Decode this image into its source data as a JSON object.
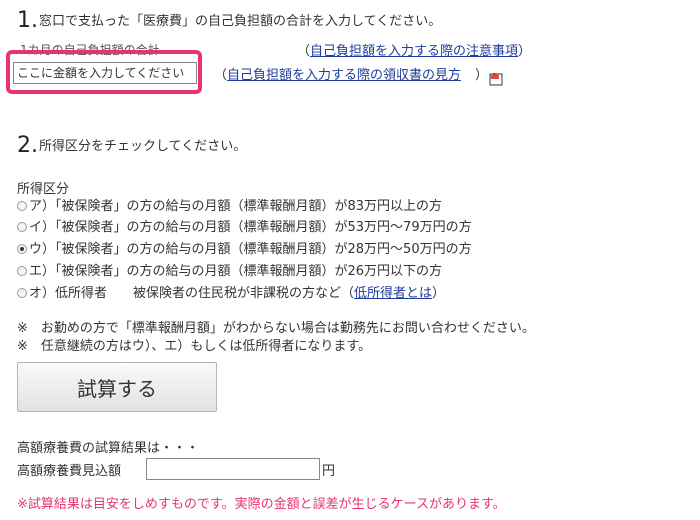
{
  "section1": {
    "number": "1.",
    "heading": "窓口で支払った「医療費」の自己負担額の合計を入力してください。",
    "field_label": "1カ月の自己負担額の合計",
    "input_placeholder": "ここに金額を入力してください",
    "link_notes_open": "（",
    "link_notes": "自己負担額を入力する際の注意事項",
    "link_notes_close": "）",
    "link_receipt_open": "（",
    "link_receipt": "自己負担額を入力する際の領収書の見方",
    "link_receipt_close": "）"
  },
  "section2": {
    "number": "2.",
    "heading": "所得区分をチェックしてください。",
    "group_label": "所得区分",
    "options": [
      {
        "label": "ア）「被保険者」の方の給与の月額（標準報酬月額）が83万円以上の方",
        "checked": false
      },
      {
        "label": "イ）「被保険者」の方の給与の月額（標準報酬月額）が53万円～79万円の方",
        "checked": false
      },
      {
        "label": "ウ）「被保険者」の方の給与の月額（標準報酬月額）が28万円～50万円の方",
        "checked": true
      },
      {
        "label": "エ）「被保険者」の方の給与の月額（標準報酬月額）が26万円以下の方",
        "checked": false
      }
    ],
    "option_o_label": "オ）低所得者　　被保険者の住民税が非課税の方など（",
    "option_o_link": "低所得者とは",
    "option_o_close": "）",
    "note1": "※　お勤めの方で「標準報酬月額」がわからない場合は勤務先にお問い合わせください。",
    "note2": "※　任意継続の方はウ）、エ）もしくは低所得者になります。"
  },
  "calc_button": "試算する",
  "result": {
    "heading": "高額療養費の試算結果は・・・",
    "field_label": "高額療養費見込額",
    "unit": "円",
    "warning": "※試算結果は目安をしめすものです。実際の金額と誤差が生じるケースがあります。"
  },
  "colors": {
    "highlight": "#e8336e",
    "link": "#1f3c9e",
    "warning": "#e8336e"
  }
}
